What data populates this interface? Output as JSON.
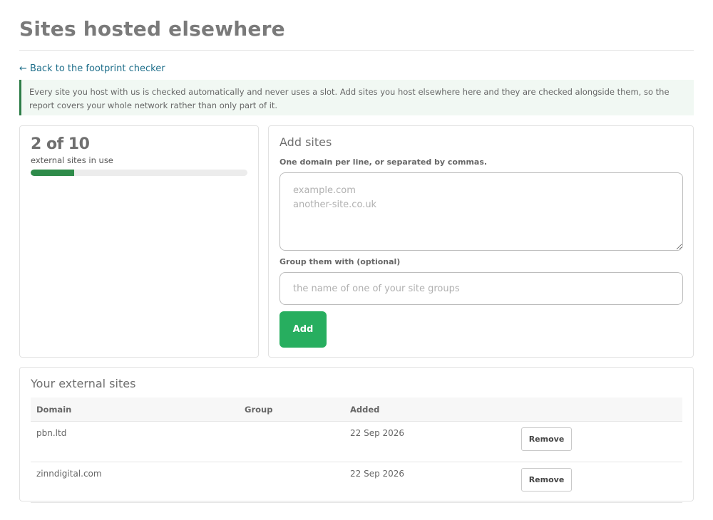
{
  "page": {
    "title": "Sites hosted elsewhere",
    "back_link": "← Back to the footprint checker",
    "notice": "Every site you host with us is checked automatically and never uses a slot. Add sites you host elsewhere here and they are checked alongside them, so the report covers your whole network rather than only part of it."
  },
  "usage": {
    "count_text": "2 of 10",
    "label": "external sites in use",
    "used": 2,
    "total": 10,
    "fill_color": "#2e8b4a"
  },
  "add_sites": {
    "title": "Add sites",
    "domains_label": "One domain per line, or separated by commas.",
    "domains_placeholder": "example.com\nanother-site.co.uk",
    "group_label": "Group them with (optional)",
    "group_placeholder": "the name of one of your site groups",
    "add_label": "Add",
    "accent_color": "#27ae5f"
  },
  "external_sites": {
    "title": "Your external sites",
    "columns": {
      "domain": "Domain",
      "group": "Group",
      "added": "Added"
    },
    "rows": [
      {
        "domain": "pbn.ltd",
        "group": "",
        "added": "22 Sep 2026",
        "action": "Remove"
      },
      {
        "domain": "zinndigital.com",
        "group": "",
        "added": "22 Sep 2026",
        "action": "Remove"
      }
    ]
  }
}
